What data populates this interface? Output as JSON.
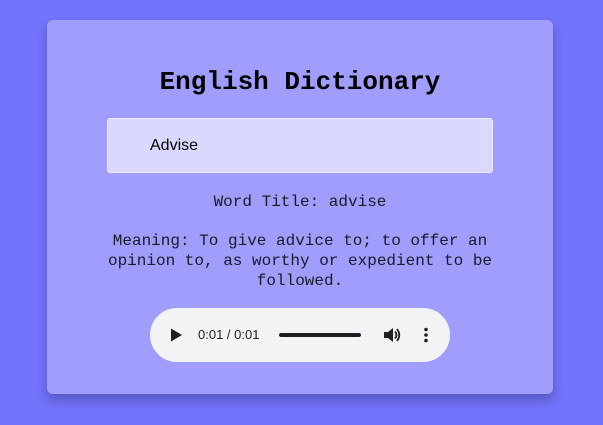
{
  "app": {
    "title": "English Dictionary"
  },
  "search": {
    "value": "Advise"
  },
  "result": {
    "word_title": "Word Title: advise",
    "meaning": "Meaning: To give advice to; to offer an opinion to, as worthy or expedient to be followed."
  },
  "audio": {
    "time": "0:01 / 0:01",
    "progress": 1.0,
    "icons": {
      "play": "play-icon",
      "volume": "volume-icon",
      "more": "more-vert-icon"
    }
  },
  "colors": {
    "background": "#7373fb",
    "card": "#a19dfc",
    "input": "#dad9fd",
    "player": "#f1f3f4"
  }
}
